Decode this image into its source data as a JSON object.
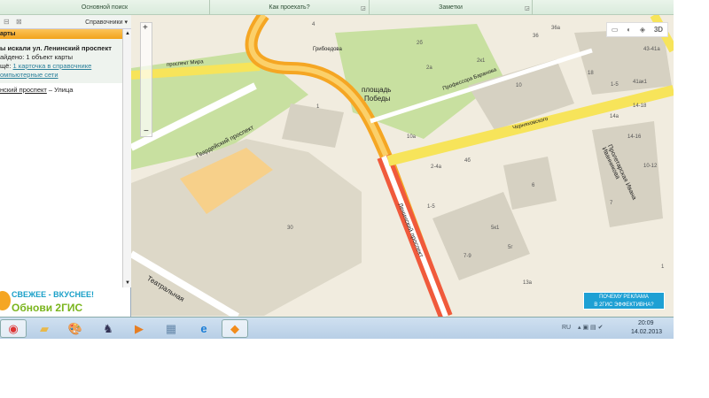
{
  "ribbon": {
    "groups": [
      "Основной поиск",
      "Как проехать?",
      "Заметки"
    ]
  },
  "left_panel": {
    "directory_menu": "Справочники ▾",
    "header": "арты",
    "results": {
      "line1": "ы искали ул. Ленинский проспект",
      "line2": "айдено: 1 объект карты",
      "line3_prefix": "щё: ",
      "line3_link": "1 карточка в справочнике",
      "line4_link": "омпьютерные сети"
    },
    "item": {
      "name": "нский проспект",
      "type": " – Улица"
    },
    "ad": {
      "line1": "СВЕЖЕЕ - ВКУСНЕЕ!",
      "line2": "Обнови 2ГИС"
    }
  },
  "map": {
    "labels": {
      "prospekt_mira": "проспект Мира",
      "gvardeisky": "Гвардейский проспект",
      "leninsky": "Ленинский проспект",
      "teatralnaya": "Театральная",
      "ploshad1": "площадь",
      "ploshad2": "Победы",
      "baranova": "Профессора Баранова",
      "chernyakhovskogo": "Черняховского",
      "ivannikova": "Пролетарская Ивана Иванникова",
      "griboedova": "Грибоедова"
    },
    "houses": [
      "1",
      "30",
      "4",
      "2б",
      "2а",
      "2к1",
      "36",
      "36а",
      "10",
      "18",
      "1-5",
      "43-41а",
      "41ак1",
      "14-18",
      "14а",
      "14-16",
      "10а",
      "2-4а",
      "4б",
      "6",
      "7",
      "10-12",
      "1-5",
      "5к1",
      "7-9",
      "5г",
      "13а",
      "1"
    ],
    "controls": {
      "zoom_in": "+",
      "zoom_out": "−",
      "mode_3d": "3D"
    },
    "ad_button": {
      "line1": "ПОЧЕМУ РЕКЛАМА",
      "line2": "В 2ГИС ЭФФЕКТИВНА?"
    }
  },
  "taskbar": {
    "lang": "RU",
    "time": "20:09",
    "date": "14.02.2013"
  }
}
